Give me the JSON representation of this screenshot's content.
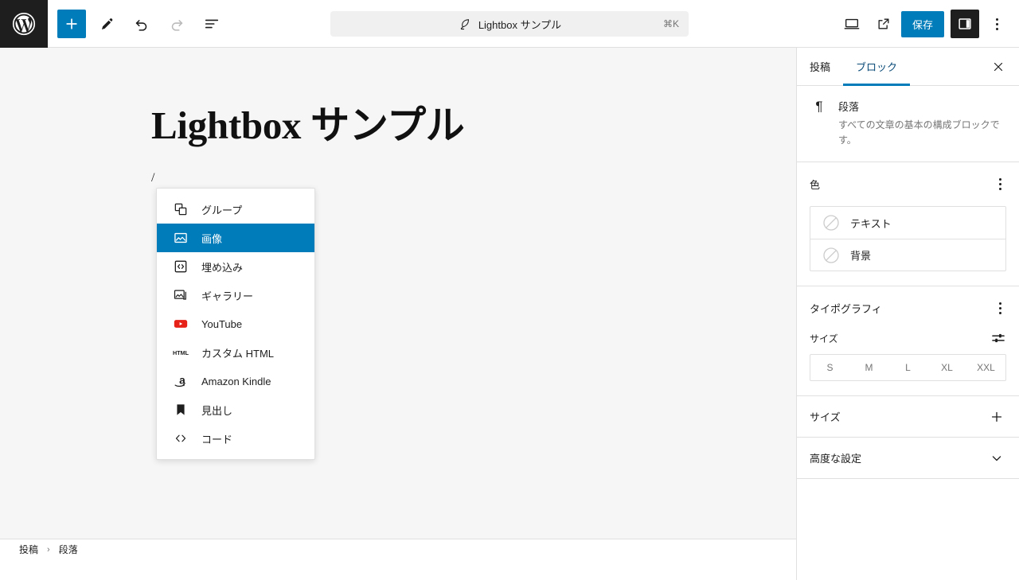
{
  "toolbar": {
    "logo_icon": "wordpress-logo-icon",
    "add_block_label": "+",
    "add_block_icon": "plus-icon",
    "tools_icon": "pencil-edit-icon",
    "undo_icon": "undo-arrow-icon",
    "redo_icon": "redo-arrow-icon",
    "list_view_icon": "document-outline-icon",
    "preview_icon": "desktop-preview-icon",
    "view_icon": "external-link-icon",
    "save_label": "保存",
    "settings_icon": "sidebar-panel-icon",
    "options_icon": "more-vertical-icon"
  },
  "command_bar": {
    "icon": "feather-quill-icon",
    "title": "Lightbox サンプル",
    "shortcut": "⌘K"
  },
  "editor": {
    "post_title": "Lightbox サンプル",
    "paragraph_text": "/"
  },
  "slash_menu": {
    "items": [
      {
        "label": "グループ",
        "icon": "group-blocks-icon",
        "selected": false
      },
      {
        "label": "画像",
        "icon": "image-icon",
        "selected": true
      },
      {
        "label": "埋め込み",
        "icon": "embed-code-icon",
        "selected": false
      },
      {
        "label": "ギャラリー",
        "icon": "gallery-icon",
        "selected": false
      },
      {
        "label": "YouTube",
        "icon": "youtube-icon",
        "selected": false
      },
      {
        "label": "カスタム HTML",
        "icon": "html-icon",
        "selected": false
      },
      {
        "label": "Amazon Kindle",
        "icon": "amazon-kindle-icon",
        "selected": false
      },
      {
        "label": "見出し",
        "icon": "bookmark-heading-icon",
        "selected": false
      },
      {
        "label": "コード",
        "icon": "code-brackets-icon",
        "selected": false
      }
    ]
  },
  "breadcrumb": {
    "items": [
      "投稿",
      "段落"
    ],
    "separator": "›"
  },
  "sidebar": {
    "tabs": [
      {
        "label": "投稿",
        "active": false
      },
      {
        "label": "ブロック",
        "active": true
      }
    ],
    "close_icon": "close-x-icon",
    "block_info": {
      "icon": "paragraph-pilcrow-icon",
      "glyph": "¶",
      "name": "段落",
      "description": "すべての文章の基本の構成ブロックです。"
    },
    "color_section": {
      "title": "色",
      "options_icon": "more-vertical-icon",
      "rows": [
        {
          "label": "テキスト",
          "swatch": "none"
        },
        {
          "label": "背景",
          "swatch": "none"
        }
      ]
    },
    "typography_section": {
      "title": "タイポグラフィ",
      "options_icon": "more-vertical-icon",
      "size_label": "サイズ",
      "size_settings_icon": "sliders-settings-icon",
      "size_options": [
        "S",
        "M",
        "L",
        "XL",
        "XXL"
      ],
      "size_selected": ""
    },
    "panels": [
      {
        "label": "サイズ",
        "icon": "plus-icon"
      },
      {
        "label": "高度な設定",
        "icon": "chevron-down-icon"
      }
    ]
  },
  "colors": {
    "accent": "#007cba",
    "dark": "#1e1e1e",
    "canvas": "#f6f6f6",
    "border": "#e0e0e0",
    "muted": "#757575",
    "youtube_red": "#e62117"
  }
}
